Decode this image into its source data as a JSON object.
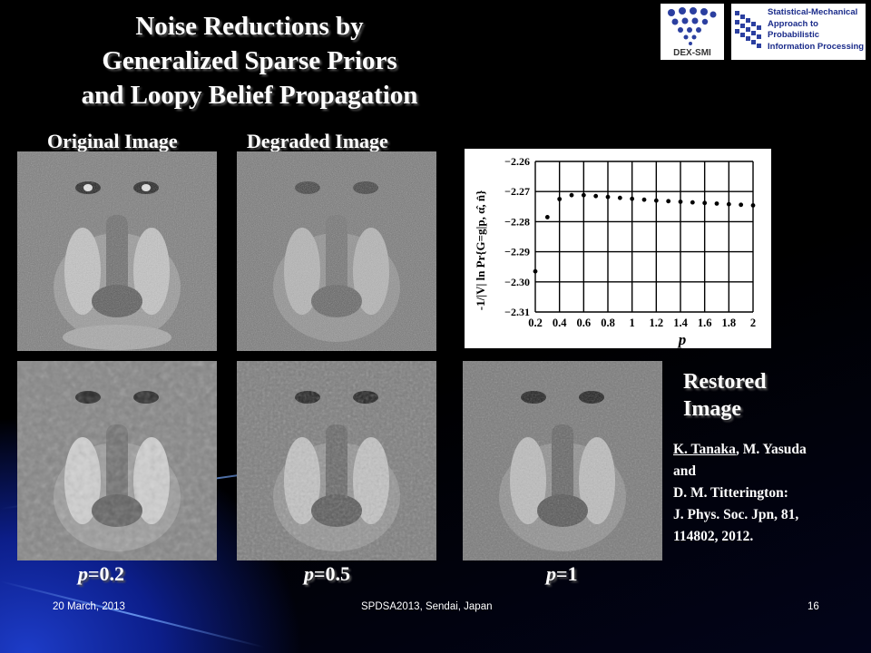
{
  "slide": {
    "title_lines": [
      "Noise Reductions by",
      "Generalized Sparse Priors",
      "and Loopy Belief Propagation"
    ],
    "logos": {
      "left_label": "DEX-SMI",
      "right_lines": [
        "Statistical-Mechanical",
        "Approach to Probabilistic",
        "Information Processing"
      ]
    },
    "captions": {
      "original": "Original Image",
      "degraded": "Degraded Image",
      "restored_line1": "Restored",
      "restored_line2": "Image"
    },
    "p_labels": [
      {
        "var": "p",
        "value": "=0.2"
      },
      {
        "var": "p",
        "value": "=0.5"
      },
      {
        "var": "p",
        "value": "=1"
      }
    ],
    "reference": {
      "author1": "K. Tanaka",
      "line1_rest": ", M. Yasuda",
      "line2": "and",
      "line3": "D. M. Titterington:",
      "line4": "J. Phys. Soc. Jpn, 81,",
      "line5": "114802, 2012."
    },
    "footer": {
      "date": "20 March, 2013",
      "venue": "SPDSA2013, Sendai, Japan",
      "page": "16"
    }
  },
  "chart_data": {
    "type": "scatter",
    "xlabel": "p",
    "ylabel": "-1/|V| ln Pr{G=g|p, α̂, n̂}",
    "x_ticks": [
      "0.2",
      "0.4",
      "0.6",
      "0.8",
      "1",
      "1.2",
      "1.4",
      "1.6",
      "1.8",
      "2"
    ],
    "y_ticks": [
      "-2.26",
      "-2.27",
      "-2.28",
      "-2.29",
      "-2.30",
      "-2.31"
    ],
    "xlim": [
      0.2,
      2.0
    ],
    "ylim": [
      -2.31,
      -2.26
    ],
    "grid": true,
    "x": [
      0.2,
      0.3,
      0.4,
      0.5,
      0.6,
      0.7,
      0.8,
      0.9,
      1.0,
      1.1,
      1.2,
      1.3,
      1.4,
      1.5,
      1.6,
      1.7,
      1.8,
      1.9,
      2.0
    ],
    "y": [
      -2.2965,
      -2.2785,
      -2.2725,
      -2.2712,
      -2.2712,
      -2.2715,
      -2.2718,
      -2.2721,
      -2.2724,
      -2.2727,
      -2.273,
      -2.2732,
      -2.2734,
      -2.2736,
      -2.2738,
      -2.274,
      -2.2742,
      -2.2744,
      -2.2746
    ]
  }
}
